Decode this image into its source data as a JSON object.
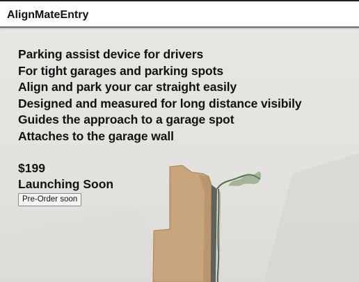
{
  "header": {
    "brand": "AlignMateEntry"
  },
  "hero": {
    "features": [
      "Parking assist device for drivers",
      "For tight garages and parking spots",
      "Align and park your car straight easily",
      "Designed and measured for long distance visibily",
      "Guides the approach to a garage spot",
      "Attaches to the garage wall"
    ],
    "price": "$199",
    "status": "Launching Soon",
    "preorder_label": "Pre-Order soon"
  }
}
